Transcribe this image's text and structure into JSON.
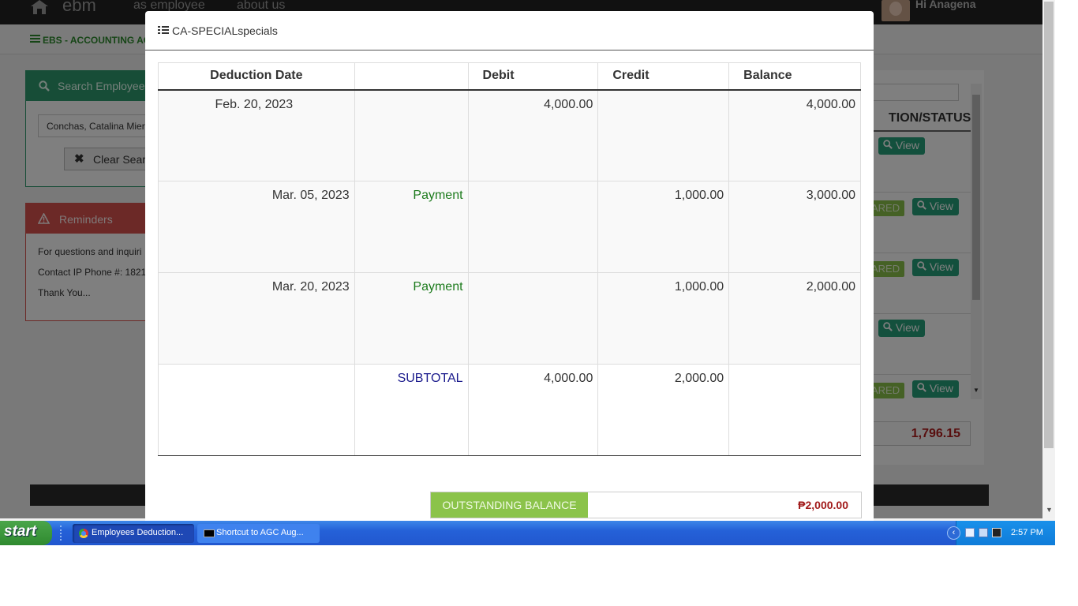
{
  "app": {
    "brand": "ebm",
    "nav": [
      "as employee",
      "about us"
    ],
    "greeting": "Hi Anagena",
    "subnav_title": "EBS - ACCOUNTING ACC"
  },
  "search_panel": {
    "title": "Search Employee",
    "value": "Conchas, Catalina Mier",
    "clear_label": "Clear Sear"
  },
  "reminders": {
    "title": "Reminders",
    "lines": [
      "For questions and inquiri",
      "Contact IP Phone #: 1821",
      "Thank You..."
    ]
  },
  "right_panel": {
    "column_header": "TION/STATUS",
    "rows": [
      {
        "status": "",
        "action": "View"
      },
      {
        "status": "ARED",
        "action": "View"
      },
      {
        "status": "ARED",
        "action": "View"
      },
      {
        "status": "",
        "action": "View"
      },
      {
        "status": "ARED",
        "action": "View"
      }
    ],
    "total": "1,796.15"
  },
  "modal": {
    "title": "CA-SPECIALspecials",
    "columns": [
      "Deduction Date",
      "",
      "Debit",
      "Credit",
      "Balance"
    ],
    "rows": [
      {
        "date": "Feb. 20, 2023",
        "type": "",
        "debit": "4,000.00",
        "credit": "",
        "balance": "4,000.00"
      },
      {
        "date": "Mar. 05, 2023",
        "type": "Payment",
        "debit": "",
        "credit": "1,000.00",
        "balance": "3,000.00"
      },
      {
        "date": "Mar. 20, 2023",
        "type": "Payment",
        "debit": "",
        "credit": "1,000.00",
        "balance": "2,000.00"
      }
    ],
    "subtotal": {
      "label": "SUBTOTAL",
      "debit": "4,000.00",
      "credit": "2,000.00"
    },
    "outstanding_label": "OUTSTANDING BALANCE",
    "outstanding_value": "₱2,000.00"
  },
  "taskbar": {
    "start": "start",
    "tasks": [
      "Employees Deduction...",
      "Shortcut to AGC Aug..."
    ],
    "clock": "2:57 PM"
  },
  "colors": {
    "search_header": "#2e9b6e",
    "reminder_header": "#d9534f",
    "payment_text": "#1b7a1b",
    "subtotal_text": "#1a1a8c",
    "outstanding_label_bg": "#8bc34a",
    "outstanding_value": "#a11a1a"
  }
}
